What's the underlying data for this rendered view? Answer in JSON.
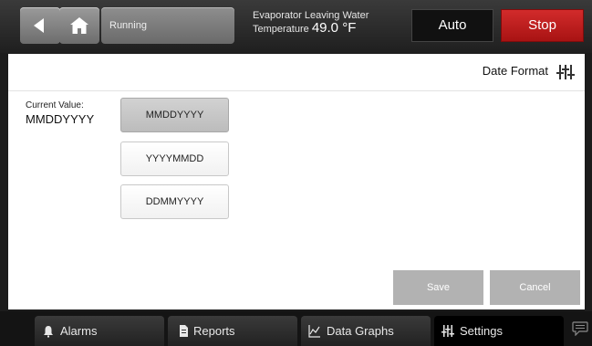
{
  "header": {
    "status_text": "Running",
    "evap_line1": "Evaporator Leaving Water",
    "evap_line2_label": "Temperature",
    "evap_value": "49.0 °F",
    "auto_label": "Auto",
    "stop_label": "Stop",
    "colors": {
      "stop_red": "#c41e1e"
    }
  },
  "page": {
    "title": "Date Format",
    "current_label": "Current Value:",
    "current_value": "MMDDYYYY",
    "options": [
      "MMDDYYYY",
      "YYYYMMDD",
      "DDMMYYYY"
    ],
    "selected_option": "MMDDYYYY",
    "save_label": "Save",
    "cancel_label": "Cancel"
  },
  "nav": {
    "tabs": [
      {
        "label": "Alarms",
        "icon": "bell-icon"
      },
      {
        "label": "Reports",
        "icon": "document-icon"
      },
      {
        "label": "Data Graphs",
        "icon": "graph-icon"
      },
      {
        "label": "Settings",
        "icon": "sliders-icon"
      }
    ],
    "active_tab": "Settings"
  }
}
